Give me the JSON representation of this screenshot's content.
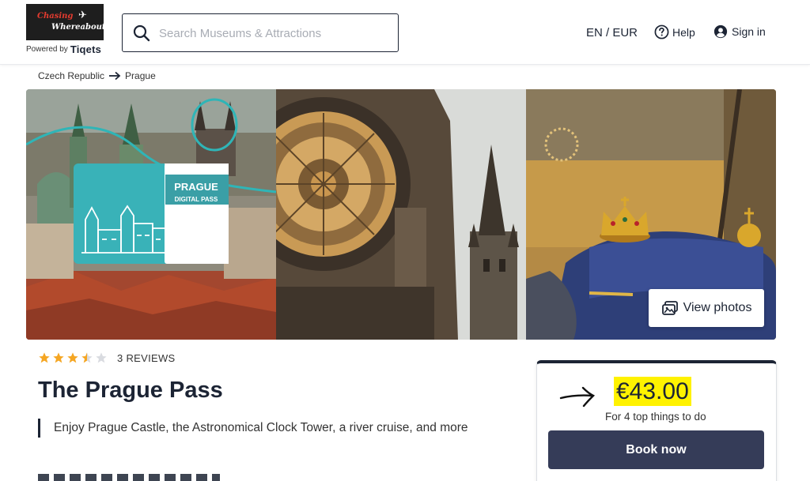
{
  "header": {
    "logo": {
      "line1": "Chasing",
      "line2": "Whereabouts"
    },
    "powered_by": "Powered by",
    "powered_brand": "Tiqets",
    "search": {
      "placeholder": "Search Museums & Attractions",
      "value": ""
    },
    "lang_currency": "EN / EUR",
    "help": "Help",
    "sign_in": "Sign in"
  },
  "breadcrumb": {
    "country": "Czech Republic",
    "city": "Prague"
  },
  "gallery": {
    "pass_card_title": "PRAGUE",
    "pass_card_sub": "DIGITAL PASS",
    "view_photos": "View photos"
  },
  "product": {
    "rating": 3.5,
    "reviews": "3 REVIEWS",
    "title": "The Prague Pass",
    "subtitle": "Enjoy Prague Castle, the Astronomical Clock Tower, a river cruise, and more"
  },
  "price_card": {
    "price": "€43.00",
    "caption": "For 4 top things to do",
    "book": "Book now"
  },
  "colors": {
    "navy": "#1c2434",
    "button": "#353c58",
    "star": "#f5a623",
    "highlight": "#fff200"
  }
}
